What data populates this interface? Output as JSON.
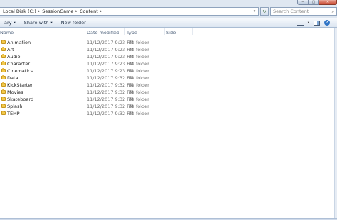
{
  "window": {
    "controls": [
      "min",
      "max",
      "close"
    ]
  },
  "address_bar": {
    "crumbs": [
      "Local Disk (C:)",
      "SessionGame",
      "Content"
    ],
    "separator": "▸",
    "dropdown": "▾",
    "refresh_icon": "refresh-icon"
  },
  "search": {
    "placeholder": "Search Content",
    "value": ""
  },
  "toolbar": {
    "organize_label": "ary",
    "share_label": "Share with",
    "new_folder_label": "New folder",
    "dropdown_glyph": "▾"
  },
  "columns": {
    "name": "Name",
    "date": "Date modified",
    "type": "Type",
    "size": "Size"
  },
  "files": [
    {
      "name": "Animation",
      "date": "11/12/2017 9:23 PM",
      "type": "File folder"
    },
    {
      "name": "Art",
      "date": "11/12/2017 9:23 PM",
      "type": "File folder"
    },
    {
      "name": "Audio",
      "date": "11/12/2017 9:23 PM",
      "type": "File folder"
    },
    {
      "name": "Character",
      "date": "11/12/2017 9:23 PM",
      "type": "File folder"
    },
    {
      "name": "Cinematics",
      "date": "11/12/2017 9:23 PM",
      "type": "File folder"
    },
    {
      "name": "Data",
      "date": "11/12/2017 9:32 PM",
      "type": "File folder"
    },
    {
      "name": "KickStarter",
      "date": "11/12/2017 9:32 PM",
      "type": "File folder"
    },
    {
      "name": "Movies",
      "date": "11/12/2017 9:32 PM",
      "type": "File folder"
    },
    {
      "name": "Skateboard",
      "date": "11/12/2017 9:32 PM",
      "type": "File folder"
    },
    {
      "name": "Splash",
      "date": "11/12/2017 9:32 PM",
      "type": "File folder"
    },
    {
      "name": "TEMP",
      "date": "11/12/2017 9:32 PM",
      "type": "File folder"
    }
  ],
  "colors": {
    "folder": "#f2c94c",
    "chrome": "#dfe7f1",
    "toolbar": "#dbe5f1"
  }
}
